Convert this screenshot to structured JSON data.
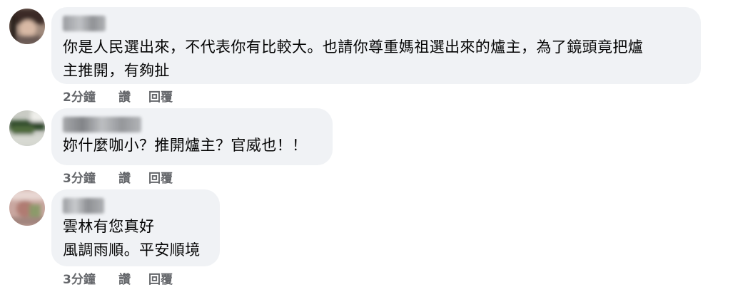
{
  "comments": [
    {
      "text": "你是人民選出來，不代表你有比較大。也請你尊重媽祖選出來的爐主，為了鏡頭竟把爐\n主推開，有夠扯",
      "time": "2分鐘",
      "like_label": "讚",
      "reply_label": "回覆"
    },
    {
      "text": "妳什麼咖小？推開爐主？官威也！！",
      "time": "3分鐘",
      "like_label": "讚",
      "reply_label": "回覆"
    },
    {
      "text": "雲林有您真好\n風調雨順。平安順境",
      "time": "3分鐘",
      "like_label": "讚",
      "reply_label": "回覆"
    }
  ],
  "colors": {
    "bubble_bg": "#f0f2f5",
    "text": "#050505",
    "secondary_text": "#65676b"
  },
  "icons": [
    "avatar"
  ]
}
